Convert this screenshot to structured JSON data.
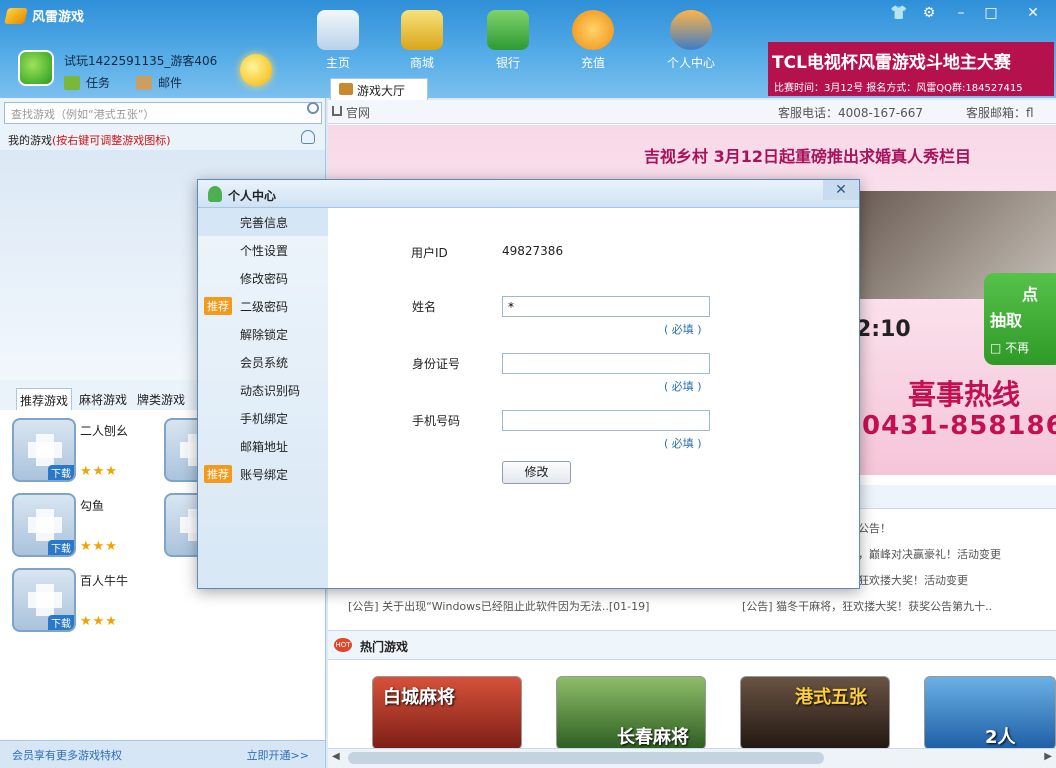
{
  "app": {
    "title": "风雷游戏"
  },
  "user": {
    "name": "试玩1422591135_游客406",
    "task_label": "任务",
    "mail_label": "邮件"
  },
  "nav": [
    {
      "label": "主页",
      "color": "#e9f2fb"
    },
    {
      "label": "商城",
      "color": "#e7c640"
    },
    {
      "label": "银行",
      "color": "#3aa845"
    },
    {
      "label": "充值",
      "color": "#f3a31b"
    },
    {
      "label": "个人中心",
      "color": "#3f7dc7"
    }
  ],
  "tcl_banner": {
    "line1": "TCL电视杯风雷游戏斗地主大赛",
    "line2": "比赛时间：3月12号 报名方式：风雷QQ群:184527415"
  },
  "search": {
    "placeholder": "查找游戏（例如“港式五张”）"
  },
  "my_games": {
    "label": "我的游戏",
    "hint": "(按右键可调整游戏图标)"
  },
  "left_tabs": [
    "推荐游戏",
    "麻将游戏",
    "牌类游戏"
  ],
  "games": [
    {
      "name": "二人刨幺",
      "download": "下载",
      "stars": "★★★"
    },
    {
      "name": "勾鱼",
      "download": "下载",
      "stars": "★★★"
    },
    {
      "name": "百人牛牛",
      "download": "下载",
      "stars": "★★★"
    }
  ],
  "left_footer": {
    "vip_text": "会员享有更多游戏特权",
    "open_label": "立即开通>>"
  },
  "hall_tab": "游戏大厅",
  "url_bar": {
    "home": "官网",
    "tel": "客服电话：4008-167-667",
    "mail": "客服邮箱：fl"
  },
  "banner": {
    "headline": "吉视乡村 3月12日起重磅推出求婚真人秀栏目",
    "time_text": "2:10",
    "big1": "喜事热线",
    "big2": "0431-858186",
    "lottery_a": "点",
    "lottery_b": "抽取",
    "lottery_c": "□ 不再"
  },
  "notices": [
    "公告！",
    "，巅峰对决赢豪礼！活动变更",
    "狂欢搂大奖！活动变更",
    "[公告]    关于出现“Windows已经阻止此软件因为无法..[01-19]",
    "[公告]    猫冬干麻将，狂欢搂大奖！获奖公告第九十.."
  ],
  "hot_games": {
    "title": "热门游戏",
    "hot_badge": "HOT",
    "cards": [
      {
        "label": "白城麻将",
        "color": "#b53a2a"
      },
      {
        "label": "长春麻将",
        "color": "#4f8b3a"
      },
      {
        "label": "港式五张",
        "color": "#3b2f2a"
      },
      {
        "label": "2人",
        "color": "#2f7fc2"
      }
    ]
  },
  "dialog": {
    "title": "个人中心",
    "close": "✕",
    "menu": [
      {
        "label": "完善信息",
        "tag": ""
      },
      {
        "label": "个性设置",
        "tag": ""
      },
      {
        "label": "修改密码",
        "tag": ""
      },
      {
        "label": "二级密码",
        "tag": "推荐"
      },
      {
        "label": "解除锁定",
        "tag": ""
      },
      {
        "label": "会员系统",
        "tag": ""
      },
      {
        "label": "动态识别码",
        "tag": ""
      },
      {
        "label": "手机绑定",
        "tag": ""
      },
      {
        "label": "邮箱地址",
        "tag": ""
      },
      {
        "label": "账号绑定",
        "tag": "推荐"
      }
    ],
    "user_id_label": "用户ID",
    "user_id_value": "49827386",
    "name_label": "姓名",
    "name_value": "*",
    "id_card_label": "身份证号",
    "id_card_value": "",
    "phone_label": "手机号码",
    "phone_value": "",
    "required": "( 必填 )",
    "modify_button": "修改"
  }
}
